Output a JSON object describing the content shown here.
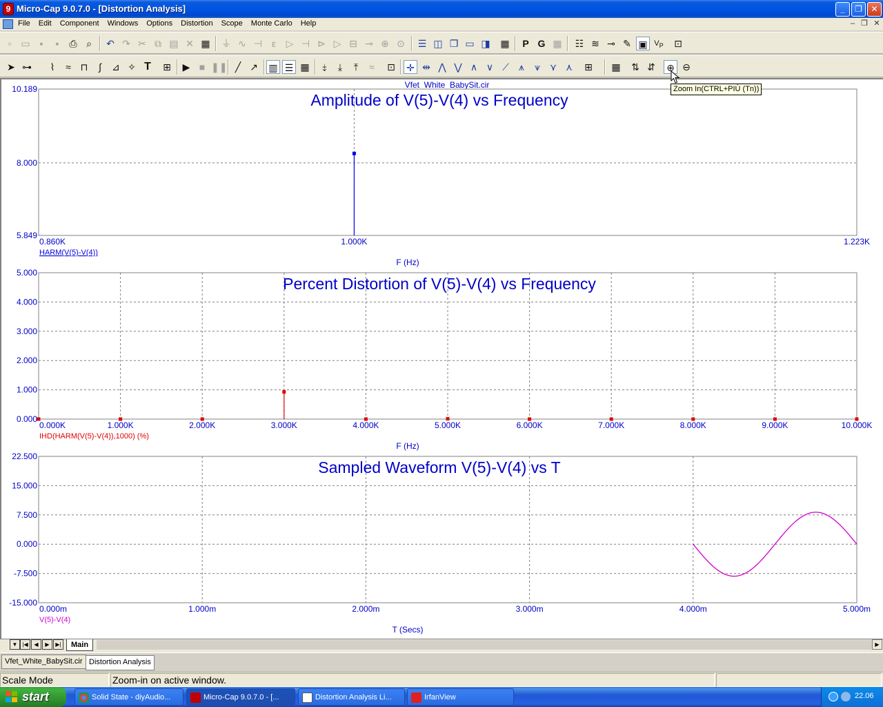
{
  "window": {
    "title": "Micro-Cap 9.0.7.0 - [Distortion Analysis]",
    "app_icon_glyph": "9"
  },
  "menu": [
    "File",
    "Edit",
    "Component",
    "Windows",
    "Options",
    "Distortion",
    "Scope",
    "Monte Carlo",
    "Help"
  ],
  "plot": {
    "circuit_name": "Vfet_White_BabySit.cir",
    "tooltip": "Zoom In(CTRL+PIÙ (Tn))"
  },
  "chart_data": [
    {
      "type": "bar",
      "title": "Amplitude of V(5)-V(4) vs Frequency",
      "xlabel": "F (Hz)",
      "expression": "HARM(V(5)-V(4))",
      "xlim": [
        0.86,
        1.223
      ],
      "ylim": [
        5.849,
        10.189
      ],
      "x_ticks": [
        "0.860K",
        "1.000K",
        "1.223K"
      ],
      "y_ticks": [
        "10.189",
        "8.000",
        "5.849"
      ],
      "x_tick_values": [
        0.86,
        1.0,
        1.223
      ],
      "y_tick_values": [
        10.189,
        8.0,
        5.849
      ],
      "x_grid": [
        1.0
      ],
      "y_grid": [
        8.0
      ],
      "color": "#0000e0",
      "points": [
        {
          "x": 1.0,
          "y": 8.28
        }
      ]
    },
    {
      "type": "bar",
      "title": "Percent Distortion of V(5)-V(4) vs Frequency",
      "xlabel": "F (Hz)",
      "expression": "IHD(HARM(V(5)-V(4)),1000) (%)",
      "xlim": [
        0,
        10
      ],
      "ylim": [
        0,
        5
      ],
      "x_ticks": [
        "0.000K",
        "1.000K",
        "2.000K",
        "3.000K",
        "4.000K",
        "5.000K",
        "6.000K",
        "7.000K",
        "8.000K",
        "9.000K",
        "10.000K"
      ],
      "y_ticks": [
        "5.000",
        "4.000",
        "3.000",
        "2.000",
        "1.000",
        "0.000"
      ],
      "x_tick_values": [
        0,
        1,
        2,
        3,
        4,
        5,
        6,
        7,
        8,
        9,
        10
      ],
      "y_tick_values": [
        5,
        4,
        3,
        2,
        1,
        0
      ],
      "x_grid": [
        1,
        2,
        3,
        4,
        5,
        6,
        7,
        8,
        9
      ],
      "y_grid": [
        1,
        2,
        3,
        4
      ],
      "color": "#e00000",
      "points": [
        {
          "x": 0,
          "y": 0
        },
        {
          "x": 1,
          "y": 0
        },
        {
          "x": 2,
          "y": 0
        },
        {
          "x": 3,
          "y": 0.93
        },
        {
          "x": 4,
          "y": 0
        },
        {
          "x": 5,
          "y": 0.01
        },
        {
          "x": 6,
          "y": 0
        },
        {
          "x": 7,
          "y": 0
        },
        {
          "x": 8,
          "y": 0
        },
        {
          "x": 9,
          "y": 0
        },
        {
          "x": 10,
          "y": 0
        }
      ]
    },
    {
      "type": "line",
      "title": "Sampled Waveform  V(5)-V(4) vs T",
      "xlabel": "T (Secs)",
      "expression": "V(5)-V(4)",
      "xlim": [
        0,
        5
      ],
      "ylim": [
        -15,
        22.5
      ],
      "x_ticks": [
        "0.000m",
        "1.000m",
        "2.000m",
        "3.000m",
        "4.000m",
        "5.000m"
      ],
      "y_ticks": [
        "22.500",
        "15.000",
        "7.500",
        "0.000",
        "-7.500",
        "-15.000"
      ],
      "x_tick_values": [
        0,
        1,
        2,
        3,
        4,
        5
      ],
      "y_tick_values": [
        22.5,
        15,
        7.5,
        0,
        -7.5,
        -15
      ],
      "x_grid": [
        1,
        2,
        3,
        4
      ],
      "y_grid": [
        15,
        7.5,
        0,
        -7.5
      ],
      "color": "#d000d0",
      "waveform": {
        "t_start": 4.0,
        "t_end": 5.0,
        "amplitude": 8.2,
        "frequency_khz": 1.0,
        "phase": "negative-sine"
      }
    }
  ],
  "tabs": {
    "sheet": "Main",
    "docs": [
      "Vfet_White_BabySit.cir",
      "Distortion Analysis"
    ]
  },
  "status": {
    "mode": "Scale Mode",
    "message": "Zoom-in on active window."
  },
  "taskbar": {
    "start": "start",
    "tasks": [
      "Solid State - diyAudio...",
      "Micro-Cap 9.0.7.0 - [...",
      "Distortion Analysis Li...",
      "IrfanView"
    ],
    "clock": "22.06"
  },
  "colors": {
    "title_blue": "#0000c8",
    "grid": "#808080"
  }
}
